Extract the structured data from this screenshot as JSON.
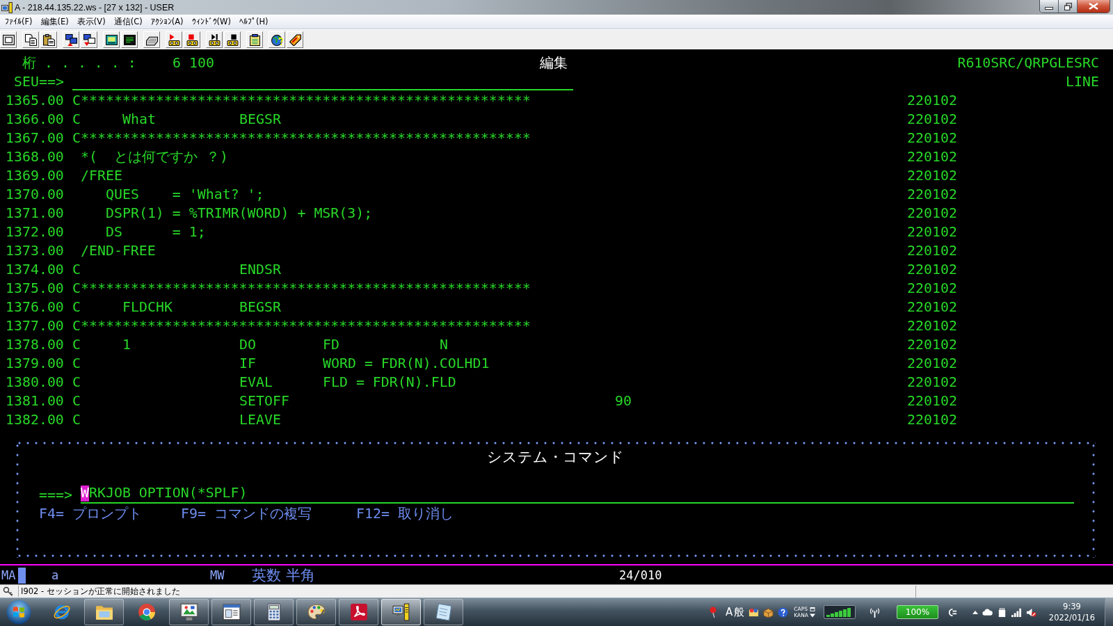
{
  "window": {
    "title": "A - 218.44.135.22.ws - [27 x 132] - USER"
  },
  "menu": [
    "ﾌｧｲﾙ(F)",
    "編集(E)",
    "表示(V)",
    "通信(C)",
    "ｱｸｼｮﾝ(A)",
    "ｳｨﾝﾄﾞｳ(W)",
    "ﾍﾙﾌﾟ(H)"
  ],
  "screen": {
    "columns_label": "桁 . . . . . :",
    "columns_value": "6 100",
    "title": "編集",
    "member": "R610SRC/QRPGLESRC",
    "prompt": "SEU==>",
    "mode": "LINE",
    "lines": [
      {
        "seq": "1365.00",
        "kind": "comment",
        "text": "C******************************************************",
        "date": "220102"
      },
      {
        "seq": "1366.00",
        "kind": "calc",
        "spec": "C",
        "factor1": "What",
        "opcode": "BEGSR",
        "date": "220102"
      },
      {
        "seq": "1367.00",
        "kind": "comment",
        "text": "C******************************************************",
        "date": "220102"
      },
      {
        "seq": "1368.00",
        "kind": "directive",
        "text": "*(  とは何ですか ？)",
        "date": "220102"
      },
      {
        "seq": "1369.00",
        "kind": "directive",
        "text": "/FREE",
        "date": "220102"
      },
      {
        "seq": "1370.00",
        "kind": "free",
        "text": "QUES    = 'What? ';",
        "date": "220102"
      },
      {
        "seq": "1371.00",
        "kind": "free",
        "text": "DSPR(1) = %TRIMR(WORD) + MSR(3);",
        "date": "220102"
      },
      {
        "seq": "1372.00",
        "kind": "free",
        "text": "DS      = 1;",
        "date": "220102"
      },
      {
        "seq": "1373.00",
        "kind": "directive",
        "text": "/END-FREE",
        "date": "220102"
      },
      {
        "seq": "1374.00",
        "kind": "calc",
        "spec": "C",
        "opcode": "ENDSR",
        "date": "220102"
      },
      {
        "seq": "1375.00",
        "kind": "comment",
        "text": "C******************************************************",
        "date": "220102"
      },
      {
        "seq": "1376.00",
        "kind": "calc",
        "spec": "C",
        "factor1": "FLDCHK",
        "opcode": "BEGSR",
        "date": "220102"
      },
      {
        "seq": "1377.00",
        "kind": "comment",
        "text": "C******************************************************",
        "date": "220102"
      },
      {
        "seq": "1378.00",
        "kind": "calc",
        "spec": "C",
        "factor1": "1",
        "opcode": "DO",
        "factor2": "FD",
        "result": "N",
        "date": "220102"
      },
      {
        "seq": "1379.00",
        "kind": "calc",
        "spec": "C",
        "opcode": "IF",
        "factor2": "WORD = FDR(N).COLHD1",
        "date": "220102"
      },
      {
        "seq": "1380.00",
        "kind": "calc",
        "spec": "C",
        "opcode": "EVAL",
        "factor2": "FLD = FDR(N).FLD",
        "date": "220102"
      },
      {
        "seq": "1381.00",
        "kind": "calc",
        "spec": "C",
        "opcode": "SETOFF",
        "indicator": "90",
        "date": "220102"
      },
      {
        "seq": "1382.00",
        "kind": "calc",
        "spec": "C",
        "opcode": "LEAVE",
        "date": "220102"
      }
    ],
    "command_window": {
      "title": "システム・コマンド",
      "prompt": "===>",
      "command": "WRKJOB OPTION(*SPLF)",
      "cursor": true,
      "function_keys": [
        "F4= プロンプト",
        "F9= コマンドの複写",
        "F12= 取り消し"
      ]
    }
  },
  "status_line": {
    "mode": "MA",
    "shift": "a",
    "message_waiting": "MW",
    "input_mode": "英数 半角",
    "cursor_position": "24/010"
  },
  "message_bar": {
    "text": "I902 - セッションが正常に開始されました"
  },
  "taskbar": {
    "apps": [
      {
        "running": false,
        "selected": false
      },
      {
        "running": true,
        "selected": false
      },
      {
        "running": false,
        "selected": false
      },
      {
        "running": true,
        "selected": false
      },
      {
        "running": true,
        "selected": false
      },
      {
        "running": true,
        "selected": false
      },
      {
        "running": true,
        "selected": false
      },
      {
        "running": true,
        "selected": false
      },
      {
        "running": true,
        "selected": true
      },
      {
        "running": true,
        "selected": false
      }
    ],
    "ime_mode": "A",
    "ime_kanji": "般",
    "caps": "CAPS",
    "kana": "KANA",
    "battery": "100%",
    "time": "9:39",
    "date": "2022/01/16"
  }
}
